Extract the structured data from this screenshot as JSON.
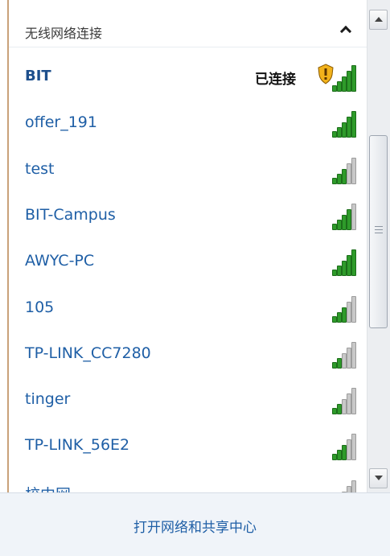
{
  "section": {
    "title": "无线网络连接",
    "toggle_icon": "chevron-up-icon"
  },
  "connected_status": "已连接",
  "networks": [
    {
      "name": "BIT",
      "signal": 5,
      "connected": true,
      "secured_warning": true
    },
    {
      "name": "offer_191",
      "signal": 5
    },
    {
      "name": "test",
      "signal": 3
    },
    {
      "name": "BIT-Campus",
      "signal": 4
    },
    {
      "name": "AWYC-PC",
      "signal": 5
    },
    {
      "name": "105",
      "signal": 3
    },
    {
      "name": "TP-LINK_CC7280",
      "signal": 2
    },
    {
      "name": "tinger",
      "signal": 2
    },
    {
      "name": "TP-LINK_56E2",
      "signal": 3
    },
    {
      "name": "校中网",
      "signal": 2
    }
  ],
  "footer": {
    "link": "打开网络和共享中心"
  },
  "colors": {
    "link": "#1f5fa6",
    "signal_on": "#2e9b2a",
    "signal_off": "#c8c8c8"
  }
}
